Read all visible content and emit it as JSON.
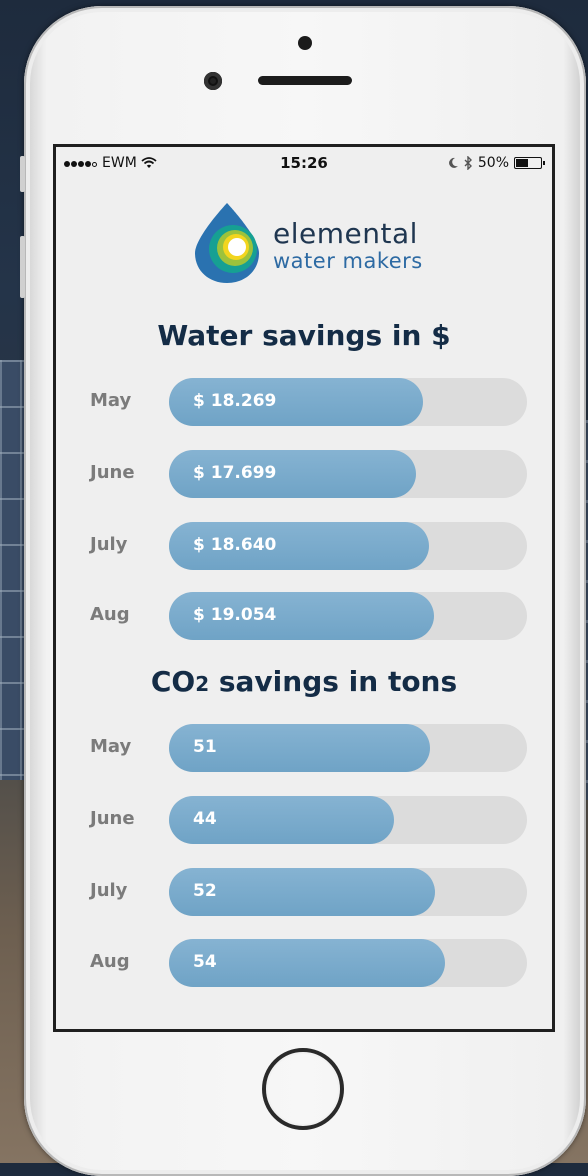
{
  "status_bar": {
    "carrier": "EWM",
    "time": "15:26",
    "battery": "50%",
    "battery_level": 0.5
  },
  "logo": {
    "line1": "elemental",
    "line2": "water makers"
  },
  "sections": [
    {
      "title": "Water savings in $",
      "max": 25.7,
      "rows": [
        {
          "month": "May",
          "value_label": "$ 18.269",
          "value": 18.269
        },
        {
          "month": "June",
          "value_label": "$ 17.699",
          "value": 17.699
        },
        {
          "month": "July",
          "value_label": "$ 18.640",
          "value": 18.64
        },
        {
          "month": "Aug",
          "value_label": "$ 19.054",
          "value": 19.054
        }
      ]
    },
    {
      "title": "CO2 savings in tons",
      "max": 70,
      "rows": [
        {
          "month": "May",
          "value_label": "51",
          "value": 51
        },
        {
          "month": "June",
          "value_label": "44",
          "value": 44
        },
        {
          "month": "July",
          "value_label": "52",
          "value": 52
        },
        {
          "month": "Aug",
          "value_label": "54",
          "value": 54
        }
      ]
    }
  ],
  "colors": {
    "bar": "#75a8ca",
    "track": "#dcdcdc",
    "title": "#142c46"
  }
}
